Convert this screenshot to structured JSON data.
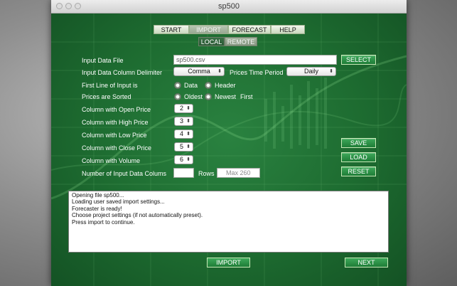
{
  "window": {
    "title": "sp500"
  },
  "tabs": [
    {
      "label": "START",
      "active": false
    },
    {
      "label": "IMPORT",
      "active": true
    },
    {
      "label": "FORECAST",
      "active": false
    },
    {
      "label": "HELP",
      "active": false
    }
  ],
  "subtabs": [
    {
      "label": "LOCAL",
      "active": true
    },
    {
      "label": "REMOTE",
      "active": false
    }
  ],
  "form": {
    "input_file_label": "Input Data File",
    "input_file_value": "sp500.csv",
    "delimiter_label": "Input Data Column Delimiter",
    "delimiter_value": "Comma",
    "time_period_label": "Prices Time Period",
    "time_period_value": "Daily",
    "first_line_label": "First Line of Input is",
    "first_line_options": [
      "Data",
      "Header"
    ],
    "first_line_selected": "Header",
    "sorted_label": "Prices are Sorted",
    "sorted_options": [
      "Oldest",
      "Newest"
    ],
    "sorted_selected": "Newest",
    "sorted_suffix": "First",
    "open_label": "Column with Open Price",
    "open_value": "2",
    "high_label": "Column with High Price",
    "high_value": "3",
    "low_label": "Column with Low Price",
    "low_value": "4",
    "close_label": "Column with Close Price",
    "close_value": "5",
    "volume_label": "Column with Volume",
    "volume_value": "6",
    "columns_label": "Number of Input Data Colums",
    "columns_value": "",
    "rows_label": "Rows",
    "rows_placeholder": "Max 260"
  },
  "buttons": {
    "select": "SELECT",
    "save": "SAVE",
    "load": "LOAD",
    "reset": "RESET",
    "import": "IMPORT",
    "next": "NEXT"
  },
  "log_lines": [
    "Opening file sp500...",
    "Loading user saved import settings...",
    "Forecaster is ready!",
    "Choose project settings (if not automatically preset).",
    "",
    "Press import to continue."
  ],
  "colors": {
    "panel_green": "#1f6b33",
    "button_green": "#2f9a4b",
    "tab_active": "#a3b29e"
  }
}
